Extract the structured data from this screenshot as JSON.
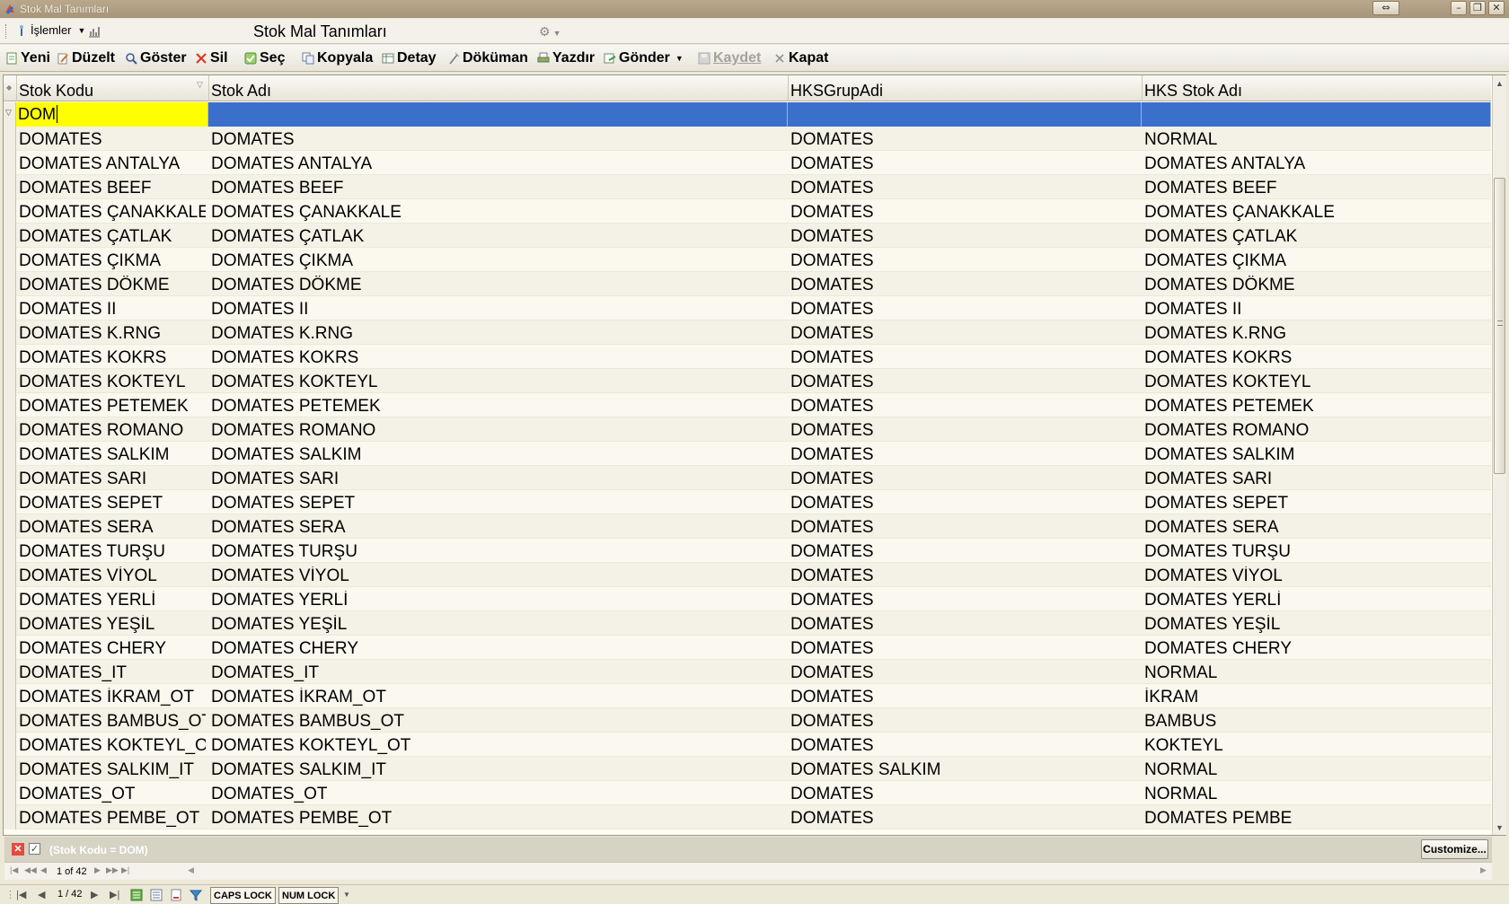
{
  "window": {
    "title": "Stok Mal Tanımları",
    "buttons": [
      "⇔",
      "–",
      "❐",
      "✕"
    ]
  },
  "menubar": {
    "menu_label": "İşlemler",
    "form_title": "Stok Mal Tanımları"
  },
  "toolbar": {
    "items": [
      {
        "label": "Yeni",
        "icon": "new-doc-icon"
      },
      {
        "label": "Düzelt",
        "icon": "edit-icon"
      },
      {
        "label": "Göster",
        "icon": "view-icon"
      },
      {
        "label": "Sil",
        "icon": "delete-icon"
      },
      {
        "label": "Seç",
        "icon": "select-icon"
      },
      {
        "label": "Kopyala",
        "icon": "copy-icon"
      },
      {
        "label": "Detay",
        "icon": "detail-icon"
      },
      {
        "label": "Döküman",
        "icon": "document-icon"
      },
      {
        "label": "Yazdır",
        "icon": "print-icon"
      },
      {
        "label": "Gönder",
        "icon": "send-icon"
      },
      {
        "label": "Kaydet",
        "icon": "save-icon",
        "disabled": true
      },
      {
        "label": "Kapat",
        "icon": "close-icon"
      }
    ]
  },
  "grid": {
    "columns": [
      "Stok Kodu",
      "Stok Adı",
      "HKSGrupAdi",
      "HKS Stok Adı"
    ],
    "filter_value": "DOM",
    "rows": [
      [
        "DOMATES",
        "DOMATES",
        "DOMATES",
        "NORMAL"
      ],
      [
        "DOMATES ANTALYA",
        "DOMATES ANTALYA",
        "DOMATES",
        "DOMATES ANTALYA"
      ],
      [
        "DOMATES BEEF",
        "DOMATES BEEF",
        "DOMATES",
        "DOMATES BEEF"
      ],
      [
        "DOMATES ÇANAKKALE",
        "DOMATES ÇANAKKALE",
        "DOMATES",
        "DOMATES ÇANAKKALE"
      ],
      [
        "DOMATES ÇATLAK",
        "DOMATES ÇATLAK",
        "DOMATES",
        "DOMATES ÇATLAK"
      ],
      [
        "DOMATES ÇIKMA",
        "DOMATES ÇIKMA",
        "DOMATES",
        "DOMATES ÇIKMA"
      ],
      [
        "DOMATES DÖKME",
        "DOMATES DÖKME",
        "DOMATES",
        "DOMATES DÖKME"
      ],
      [
        "DOMATES II",
        "DOMATES II",
        "DOMATES",
        "DOMATES II"
      ],
      [
        "DOMATES K.RNG",
        "DOMATES K.RNG",
        "DOMATES",
        "DOMATES K.RNG"
      ],
      [
        "DOMATES KOKRS",
        "DOMATES KOKRS",
        "DOMATES",
        "DOMATES KOKRS"
      ],
      [
        "DOMATES KOKTEYL",
        "DOMATES KOKTEYL",
        "DOMATES",
        "DOMATES KOKTEYL"
      ],
      [
        "DOMATES PETEMEK",
        "DOMATES PETEMEK",
        "DOMATES",
        "DOMATES PETEMEK"
      ],
      [
        "DOMATES ROMANO",
        "DOMATES ROMANO",
        "DOMATES",
        "DOMATES ROMANO"
      ],
      [
        "DOMATES SALKIM",
        "DOMATES SALKIM",
        "DOMATES",
        "DOMATES SALKIM"
      ],
      [
        "DOMATES SARI",
        "DOMATES SARI",
        "DOMATES",
        "DOMATES SARI"
      ],
      [
        "DOMATES SEPET",
        "DOMATES SEPET",
        "DOMATES",
        "DOMATES SEPET"
      ],
      [
        "DOMATES SERA",
        "DOMATES SERA",
        "DOMATES",
        "DOMATES SERA"
      ],
      [
        "DOMATES TURŞU",
        "DOMATES TURŞU",
        "DOMATES",
        "DOMATES TURŞU"
      ],
      [
        "DOMATES VİYOL",
        "DOMATES VİYOL",
        "DOMATES",
        "DOMATES VİYOL"
      ],
      [
        "DOMATES YERLİ",
        "DOMATES YERLİ",
        "DOMATES",
        "DOMATES YERLİ"
      ],
      [
        "DOMATES YEŞİL",
        "DOMATES YEŞİL",
        "DOMATES",
        "DOMATES YEŞİL"
      ],
      [
        "DOMATES CHERY",
        "DOMATES CHERY",
        "DOMATES",
        "DOMATES CHERY"
      ],
      [
        "DOMATES_IT",
        "DOMATES_IT",
        "DOMATES",
        "NORMAL"
      ],
      [
        "DOMATES İKRAM_OT",
        "DOMATES İKRAM_OT",
        "DOMATES",
        "İKRAM"
      ],
      [
        "DOMATES BAMBUS_OT",
        "DOMATES BAMBUS_OT",
        "DOMATES",
        "BAMBUS"
      ],
      [
        "DOMATES KOKTEYL_OT",
        "DOMATES KOKTEYL_OT",
        "DOMATES",
        "KOKTEYL"
      ],
      [
        "DOMATES SALKIM_IT",
        "DOMATES SALKIM_IT",
        "DOMATES SALKIM",
        "NORMAL"
      ],
      [
        "DOMATES_OT",
        "DOMATES_OT",
        "DOMATES",
        "NORMAL"
      ],
      [
        "DOMATES PEMBE_OT",
        "DOMATES PEMBE_OT",
        "DOMATES",
        "DOMATES PEMBE"
      ]
    ]
  },
  "filter_panel": {
    "expression": "(Stok Kodu = DOM)",
    "customize_label": "Customize..."
  },
  "navigator": {
    "record_text": "1 of 42"
  },
  "statusbar": {
    "page_text": "1 / 42",
    "caps_lock": "CAPS LOCK",
    "num_lock": "NUM LOCK"
  },
  "colors": {
    "filter_cell_highlight": "#ffff00",
    "filter_row_selection": "#3a6fcc",
    "delete_icon": "#e24b3e"
  }
}
